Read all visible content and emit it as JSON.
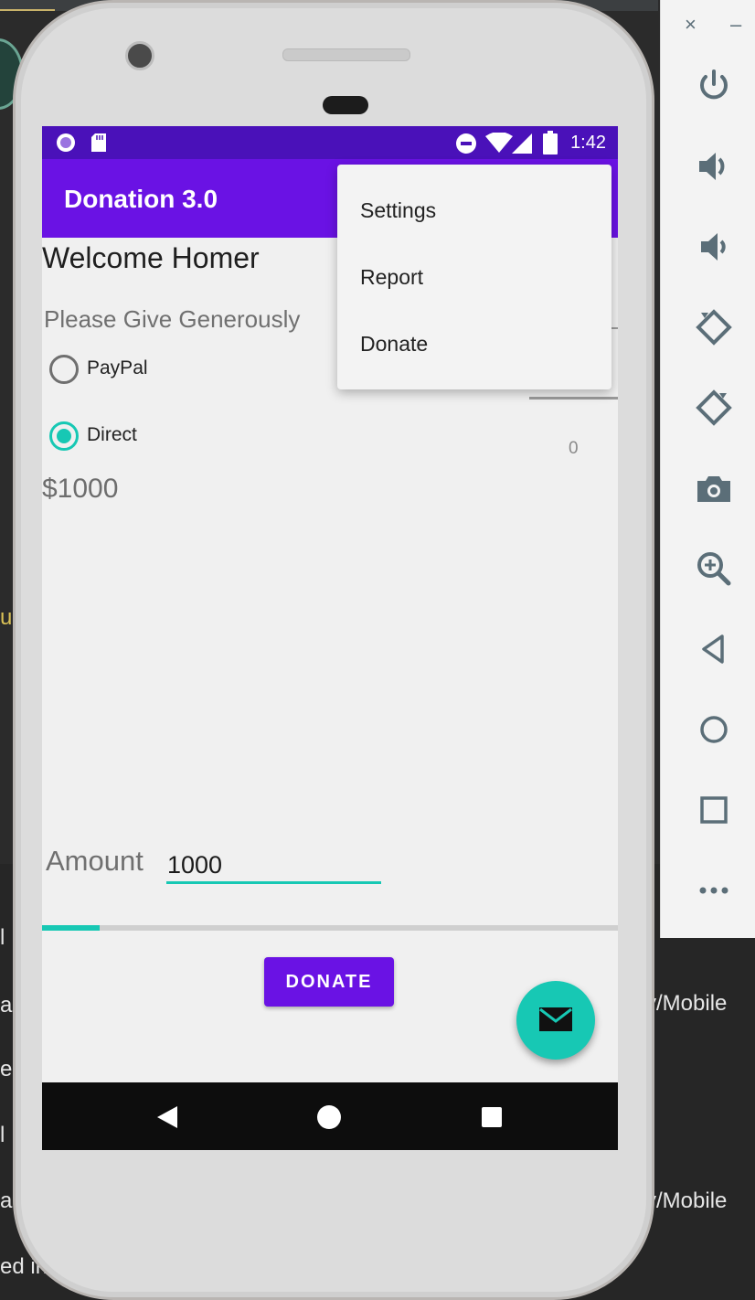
{
  "background_ide": {
    "lines": [
      {
        "text": "u"
      },
      {
        "text": "l"
      },
      {
        "text": "a"
      },
      {
        "text": "e"
      },
      {
        "text": "l"
      },
      {
        "text": "a"
      },
      {
        "text": "ed in"
      }
    ],
    "right_fragments": [
      "y/Mobile",
      "y/Mobile"
    ]
  },
  "emulator_toolbar": {
    "close": "×",
    "minimize": "–",
    "icons": [
      "power-icon",
      "volume-up-icon",
      "volume-down-icon",
      "rotate-left-icon",
      "rotate-right-icon",
      "camera-icon",
      "zoom-icon",
      "back-icon",
      "home-icon",
      "overview-icon",
      "more-icon"
    ]
  },
  "status_bar": {
    "time": "1:42",
    "icons": [
      "circle-icon",
      "sd-card-icon",
      "do-not-disturb-icon",
      "wifi-icon",
      "signal-icon",
      "battery-icon"
    ]
  },
  "app_bar": {
    "title": "Donation 3.0"
  },
  "overflow_menu": {
    "items": [
      "Settings",
      "Report",
      "Donate"
    ]
  },
  "main": {
    "welcome": "Welcome Homer",
    "subtitle": "Please Give Generously",
    "payment_options": [
      {
        "label": "PayPal",
        "checked": false
      },
      {
        "label": "Direct",
        "checked": true
      }
    ],
    "total": "$1000",
    "picker_value": "0",
    "amount_label": "Amount",
    "amount_value": "1000",
    "progress_fraction": 0.1,
    "donate_button": "DONATE"
  },
  "colors": {
    "primary": "#6a12e4",
    "primary_dark": "#4a11b9",
    "accent": "#17c8b4"
  }
}
